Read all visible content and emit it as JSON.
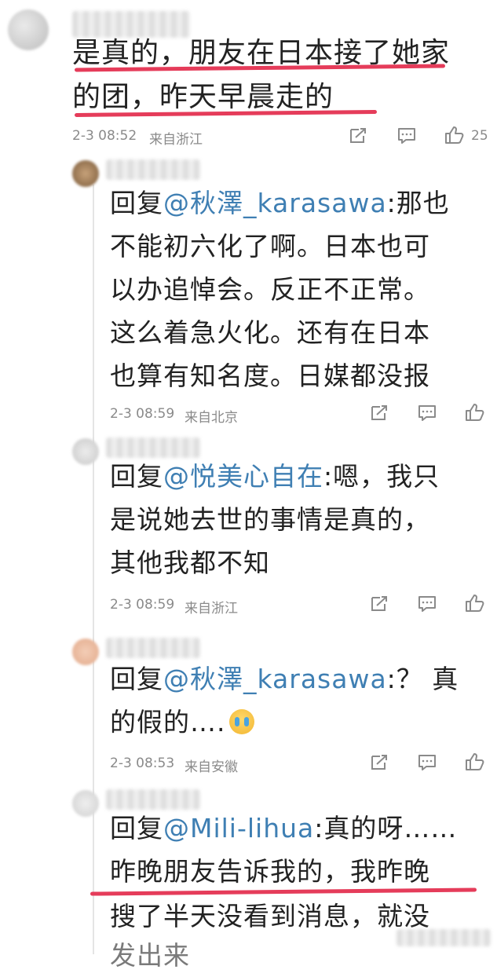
{
  "main_comment": {
    "line1": "是真的，朋友在日本接了她家",
    "line2": "的团，昨天早晨走的",
    "time": "2-3 08:52",
    "location": "来自浙江",
    "like_count": "25"
  },
  "replies": [
    {
      "prefix": "回复",
      "mention": "@秋澤_karasawa",
      "lines": [
        ":那也",
        "不能初六化了啊。日本也可",
        "以办追悼会。反正不正常。",
        "这么着急火化。还有在日本",
        "也算有知名度。日媒都没报"
      ],
      "time": "2-3 08:59",
      "location": "来自北京"
    },
    {
      "prefix": "回复",
      "mention": "@悦美心自在",
      "lines": [
        ":嗯，我只",
        "是说她去世的事情是真的，",
        "其他我都不知"
      ],
      "time": "2-3 08:59",
      "location": "来自浙江"
    },
    {
      "prefix": "回复",
      "mention": "@秋澤_karasawa",
      "lines": [
        ":？ 真",
        "的假的…."
      ],
      "time": "2-3 08:53",
      "location": "来自安徽"
    },
    {
      "prefix": "回复",
      "mention": "@Mili-lihua",
      "lines": [
        ":真的呀……",
        "昨晚朋友告诉我的，我昨晚",
        "搜了半天没看到消息，就没",
        "发出来"
      ],
      "time": "",
      "location": ""
    }
  ],
  "icons": {
    "share": "share-icon",
    "comment": "comment-icon",
    "like": "thumbs-up-icon",
    "emoji": "crying-emoji-icon"
  },
  "colors": {
    "mention": "#3f7fb3",
    "underline": "#e53c5a",
    "meta": "#8a8a8a"
  }
}
